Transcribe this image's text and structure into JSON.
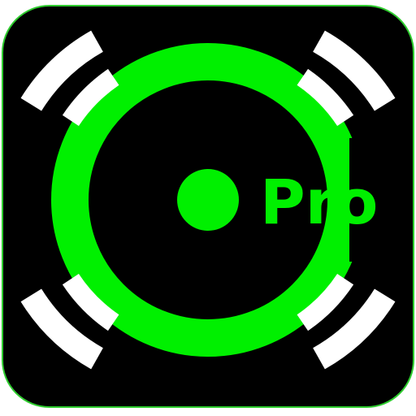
{
  "app_icon": {
    "label": "Pro",
    "icon_name": "camera-pro-app-icon",
    "colors": {
      "background": "#000000",
      "accent": "#00f000",
      "border": "#2ecc2e",
      "brackets": "#ffffff",
      "page": "#ffffff"
    }
  }
}
